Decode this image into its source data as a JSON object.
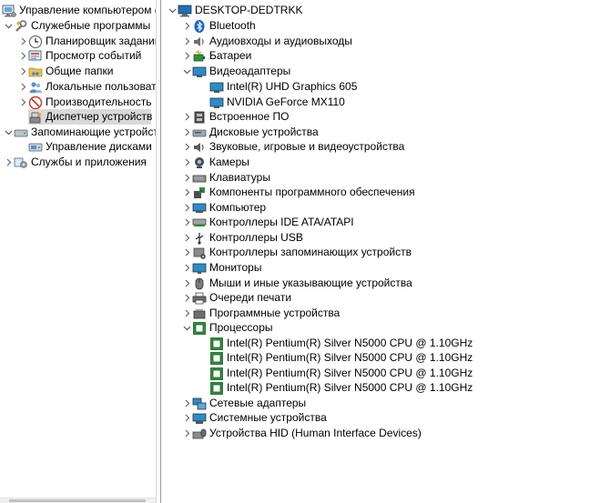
{
  "left_tree": {
    "root": "Управление компьютером (л",
    "service_tools": "Служебные программы",
    "task_scheduler": "Планировщик заданий",
    "event_viewer": "Просмотр событий",
    "shared_folders": "Общие папки",
    "local_users": "Локальные пользовате",
    "performance": "Производительность",
    "device_manager": "Диспетчер устройств",
    "storage": "Запоминающие устройства",
    "disk_management": "Управление дисками",
    "services_apps": "Службы и приложения"
  },
  "device_tree": {
    "computer_name": "DESKTOP-DEDTRKK",
    "categories": [
      "Bluetooth",
      "Аудиовходы и аудиовыходы",
      "Батареи",
      "Видеоадаптеры",
      "Встроенное ПО",
      "Дисковые устройства",
      "Звуковые, игровые и видеоустройства",
      "Камеры",
      "Клавиатуры",
      "Компоненты программного обеспечения",
      "Компьютер",
      "Контроллеры IDE ATA/ATAPI",
      "Контроллеры USB",
      "Контроллеры запоминающих устройств",
      "Мониторы",
      "Мыши и иные указывающие устройства",
      "Очереди печати",
      "Программные устройства",
      "Процессоры",
      "Сетевые адаптеры",
      "Системные устройства",
      "Устройства HID (Human Interface Devices)"
    ],
    "display_adapters": [
      "Intel(R) UHD Graphics 605",
      "NVIDIA GeForce MX110"
    ],
    "processors": [
      "Intel(R) Pentium(R) Silver N5000 CPU @ 1.10GHz",
      "Intel(R) Pentium(R) Silver N5000 CPU @ 1.10GHz",
      "Intel(R) Pentium(R) Silver N5000 CPU @ 1.10GHz",
      "Intel(R) Pentium(R) Silver N5000 CPU @ 1.10GHz"
    ]
  }
}
